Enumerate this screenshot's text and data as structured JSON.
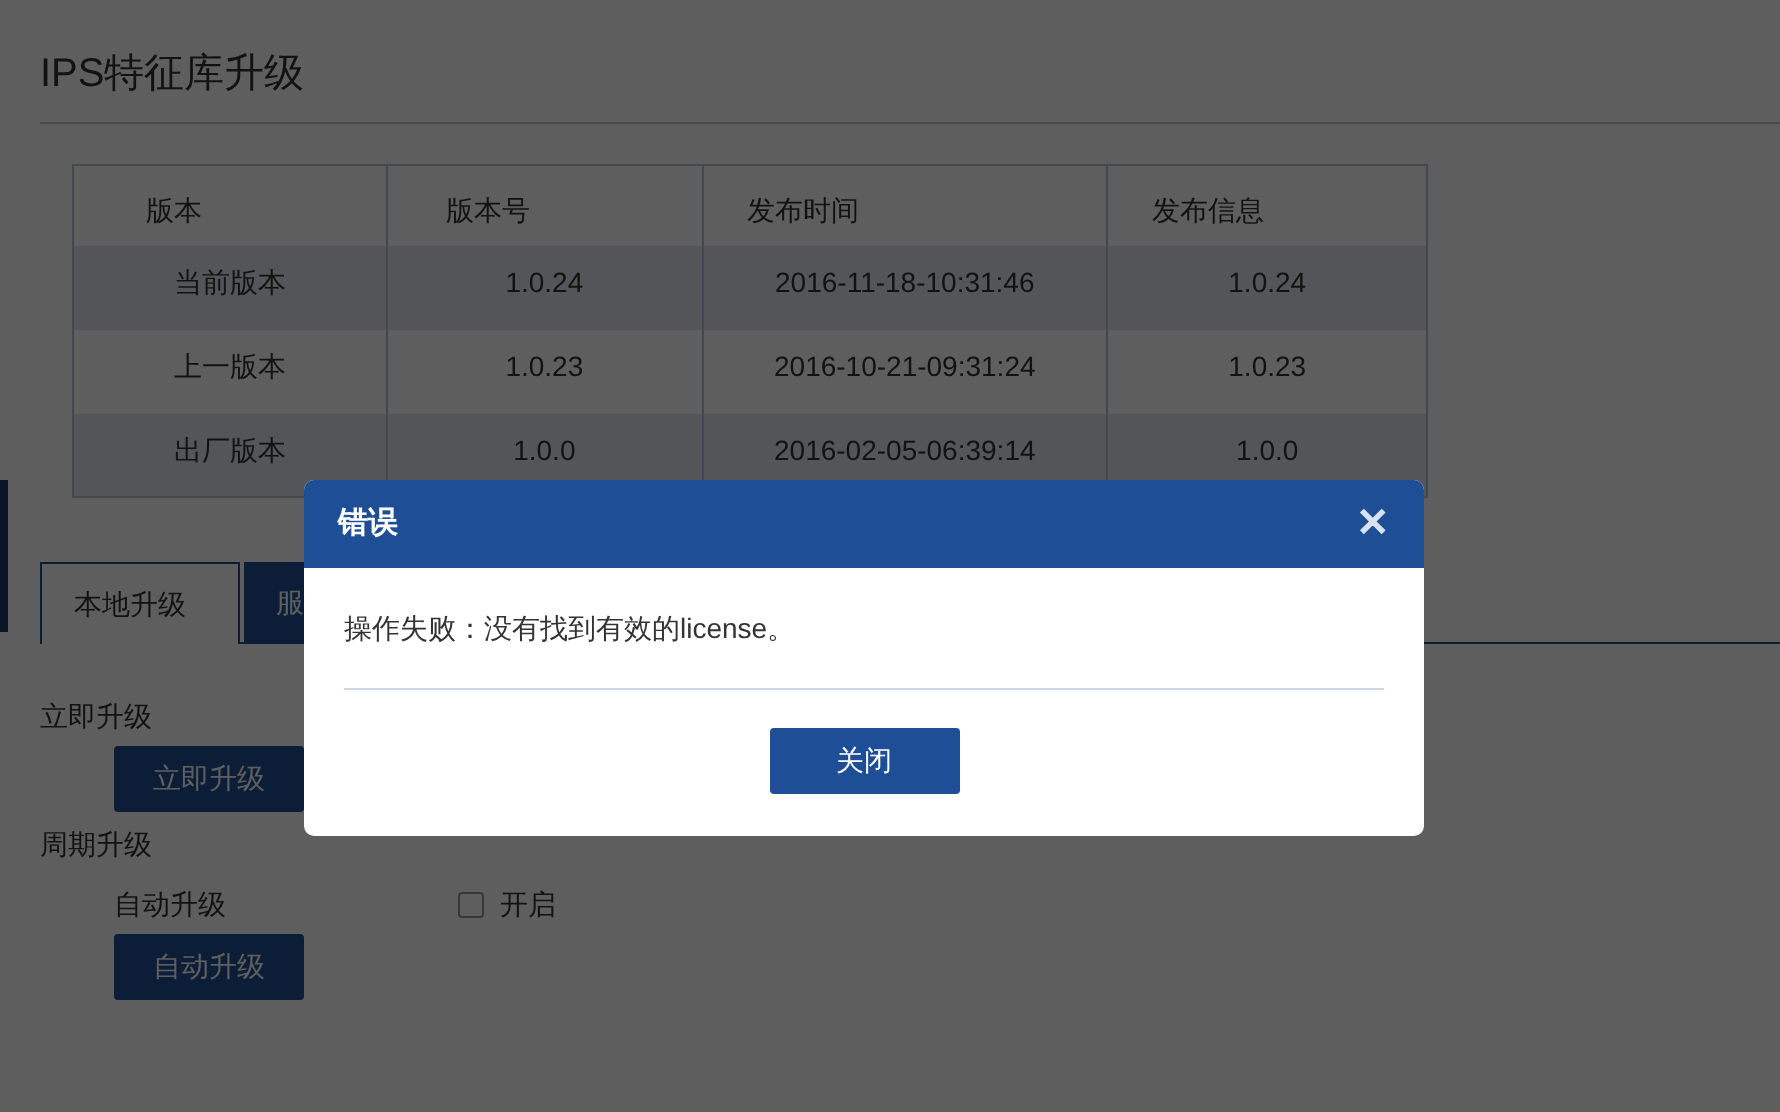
{
  "page": {
    "title": "IPS特征库升级"
  },
  "table": {
    "columns": [
      "版本",
      "版本号",
      "发布时间",
      "发布信息"
    ],
    "rows": [
      [
        "当前版本",
        "1.0.24",
        "2016-11-18-10:31:46",
        "1.0.24"
      ],
      [
        "上一版本",
        "1.0.23",
        "2016-10-21-09:31:24",
        "1.0.23"
      ],
      [
        "出厂版本",
        "1.0.0",
        "2016-02-05-06:39:14",
        "1.0.0"
      ]
    ]
  },
  "tabs": [
    {
      "label": "本地升级",
      "selected": false
    },
    {
      "label": "服",
      "selected": true
    }
  ],
  "immediate": {
    "heading": "立即升级",
    "button": "立即升级"
  },
  "periodic": {
    "heading": "周期升级",
    "label": "自动升级",
    "checkbox": {
      "label": "开启",
      "checked": false
    },
    "button": "自动升级"
  },
  "dialog": {
    "title": "错误",
    "close": "✕",
    "message": "操作失败：没有找到有效的license。",
    "button": "关闭"
  }
}
